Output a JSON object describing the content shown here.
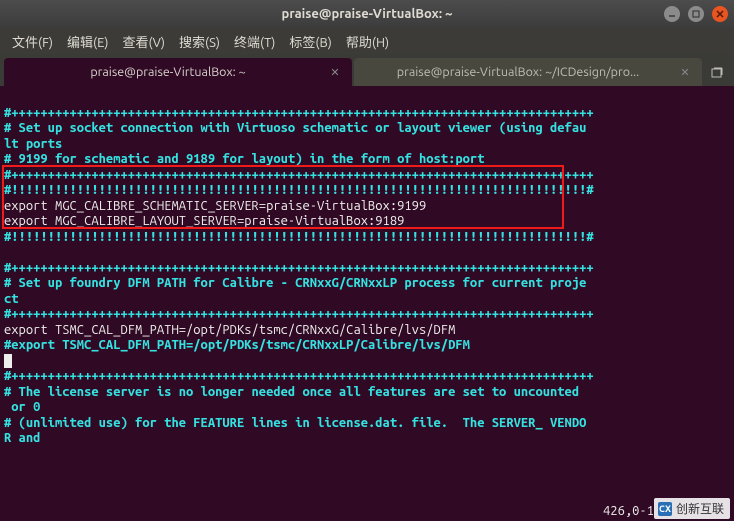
{
  "window": {
    "title": "praise@praise-VirtualBox: ~"
  },
  "menu": {
    "file": "文件(F)",
    "edit": "编辑(E)",
    "view": "查看(V)",
    "search": "搜索(S)",
    "terminal": "终端(T)",
    "tabs": "标签(B)",
    "help": "帮助(H)"
  },
  "tabs": [
    {
      "label": "praise@praise-VirtualBox: ~",
      "active": true
    },
    {
      "label": "praise@praise-VirtualBox: ~/ICDesign/pro...",
      "active": false
    }
  ],
  "terminal": {
    "line01": "#++++++++++++++++++++++++++++++++++++++++++++++++++++++++++++++++++++++++++++++++",
    "line02a": "# Set up socket connection with Virtuoso schematic or layout viewer (using defau",
    "line02b": "lt ports",
    "line03": "# 9199 for schematic and 9189 for layout) in the form of host:port",
    "line04": "#++++++++++++++++++++++++++++++++++++++++++++++++++++++++++++++++++++++++++++++++",
    "line05": "#!!!!!!!!!!!!!!!!!!!!!!!!!!!!!!!!!!!!!!!!!!!!!!!!!!!!!!!!!!!!!!!!!!!!!!!!!!!!!!!#",
    "line06": "export MGC_CALIBRE_SCHEMATIC_SERVER=praise-VirtualBox:9199",
    "line07": "export MGC_CALIBRE_LAYOUT_SERVER=praise-VirtualBox:9189",
    "line08": "#!!!!!!!!!!!!!!!!!!!!!!!!!!!!!!!!!!!!!!!!!!!!!!!!!!!!!!!!!!!!!!!!!!!!!!!!!!!!!!!#",
    "blank1": " ",
    "line09": "#++++++++++++++++++++++++++++++++++++++++++++++++++++++++++++++++++++++++++++++++",
    "line10a": "# Set up foundry DFM PATH for Calibre - CRNxxG/CRNxxLP process for current proje",
    "line10b": "ct",
    "line11": "#++++++++++++++++++++++++++++++++++++++++++++++++++++++++++++++++++++++++++++++++",
    "line12": "export TSMC_CAL_DFM_PATH=/opt/PDKs/tsmc/CRNxxG/Calibre/lvs/DFM",
    "line13": "#export TSMC_CAL_DFM_PATH=/opt/PDKs/tsmc/CRNxxLP/Calibre/lvs/DFM",
    "blank2": " ",
    "line14": "#++++++++++++++++++++++++++++++++++++++++++++++++++++++++++++++++++++++++++++++++",
    "line15a": "# The license server is no longer needed once all features are set to uncounted",
    "line15b": " or 0",
    "line16a": "# (unlimited use) for the FEATURE lines in license.dat. file.  The SERVER_ VENDO",
    "line16b": "R and"
  },
  "status": "426,0-1",
  "watermark": "创新互联"
}
